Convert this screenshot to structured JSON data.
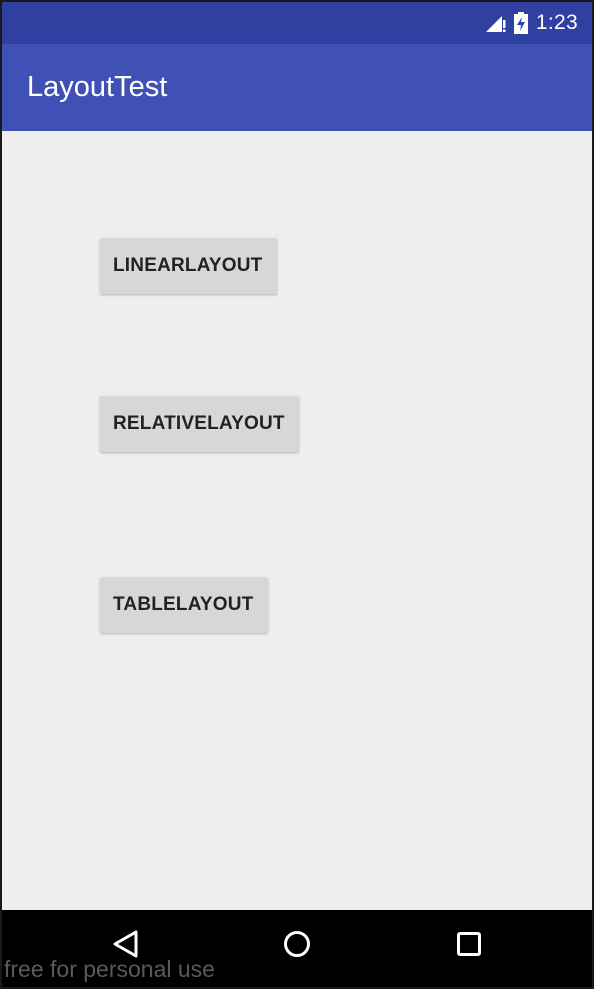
{
  "status_bar": {
    "time": "1:23",
    "icons": [
      "signal-icon",
      "battery-charging-icon"
    ],
    "color": "#3040a0"
  },
  "app_bar": {
    "title": "LayoutTest",
    "color": "#3f51b5"
  },
  "buttons": [
    {
      "label": "LINEARLAYOUT"
    },
    {
      "label": "RELATIVELAYOUT"
    },
    {
      "label": "TABLELAYOUT"
    }
  ],
  "nav_bar": {
    "icons": [
      "back-icon",
      "home-icon",
      "recent-apps-icon"
    ],
    "color": "#000000"
  },
  "watermark": "free for personal use"
}
